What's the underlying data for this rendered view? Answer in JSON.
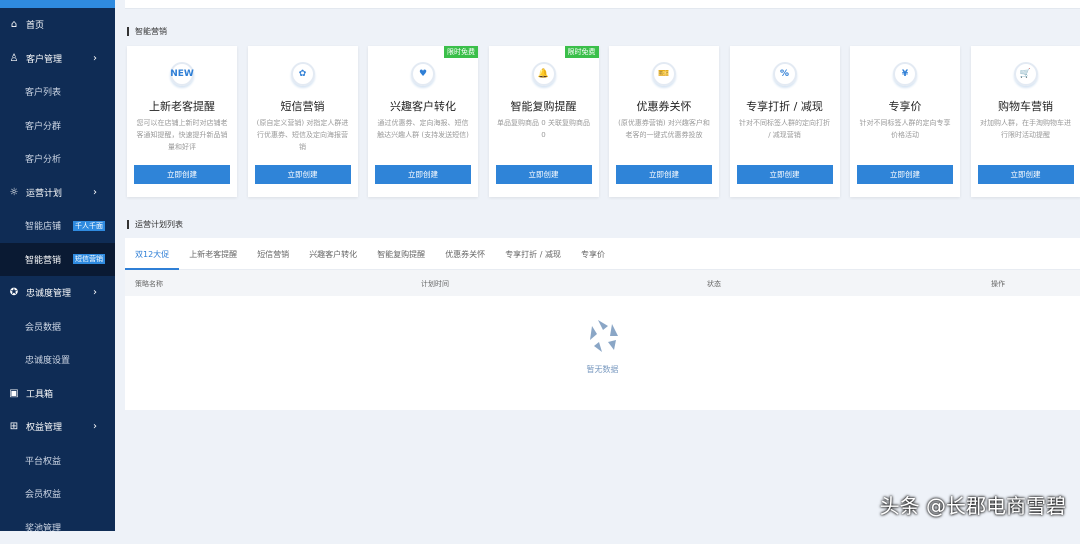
{
  "sidebar": {
    "items": [
      {
        "label": "首页",
        "icon": "home-icon",
        "top": true
      },
      {
        "label": "客户管理",
        "icon": "users-icon",
        "top": true,
        "chev": true
      },
      {
        "label": "客户列表"
      },
      {
        "label": "客户分群"
      },
      {
        "label": "客户分析"
      },
      {
        "label": "运营计划",
        "icon": "bulb-icon",
        "top": true,
        "chev": true
      },
      {
        "label": "智能店铺",
        "badge": "千人千面"
      },
      {
        "label": "智能营销",
        "badge": "短信营销",
        "active": true
      },
      {
        "label": "忠诚度管理",
        "icon": "star-circle-icon",
        "top": true,
        "chev": true
      },
      {
        "label": "会员数据"
      },
      {
        "label": "忠诚度设置"
      },
      {
        "label": "工具箱",
        "icon": "toolbox-icon",
        "top": true
      },
      {
        "label": "权益管理",
        "icon": "gift-icon",
        "top": true,
        "chev": true
      },
      {
        "label": "平台权益"
      },
      {
        "label": "会员权益"
      },
      {
        "label": "奖池管理"
      }
    ]
  },
  "section1": "智能营销",
  "cards": [
    {
      "title": "上新老客提醒",
      "desc": "您可以在店铺上新时对店铺老客通知提醒，快速提升新品销量和好评",
      "icon": "NEW",
      "btn": "立即创建"
    },
    {
      "title": "短信营销",
      "desc": "(原自定义营销) 对指定人群进行优惠券、短信及定向海报营销",
      "icon": "✿",
      "btn": "立即创建"
    },
    {
      "title": "兴趣客户转化",
      "desc": "通过优惠券、定向海报、短信触达兴趣人群 (支持发送短信)",
      "icon": "♥",
      "btn": "立即创建",
      "tag": "限时免费"
    },
    {
      "title": "智能复购提醒",
      "desc": "单品复购商品 0 关联复购商品 0",
      "icon": "🔔",
      "btn": "立即创建",
      "tag": "限时免费"
    },
    {
      "title": "优惠券关怀",
      "desc": "(原优惠券营销) 对兴趣客户和老客的一键式优惠券投放",
      "icon": "🎫",
      "btn": "立即创建"
    },
    {
      "title": "专享打折 / 减现",
      "desc": "针对不同标签人群的定向打折 / 减现营销",
      "icon": "%",
      "btn": "立即创建"
    },
    {
      "title": "专享价",
      "desc": "针对不同标签人群的定向专享价格活动",
      "icon": "¥",
      "btn": "立即创建"
    },
    {
      "title": "购物车营销",
      "desc": "对加购人群，在手淘购物车进行限时活动提醒",
      "icon": "🛒",
      "btn": "立即创建"
    }
  ],
  "section2": "运营计划列表",
  "tabs": [
    "双12大促",
    "上新老客提醒",
    "短信营销",
    "兴趣客户转化",
    "智能复购提醒",
    "优惠券关怀",
    "专享打折 / 减现",
    "专享价"
  ],
  "table": {
    "headers": [
      "策略名称",
      "计划时间",
      "状态",
      "操作"
    ],
    "empty": "暂无数据"
  },
  "watermark": "头条 @长郡电商雪碧"
}
